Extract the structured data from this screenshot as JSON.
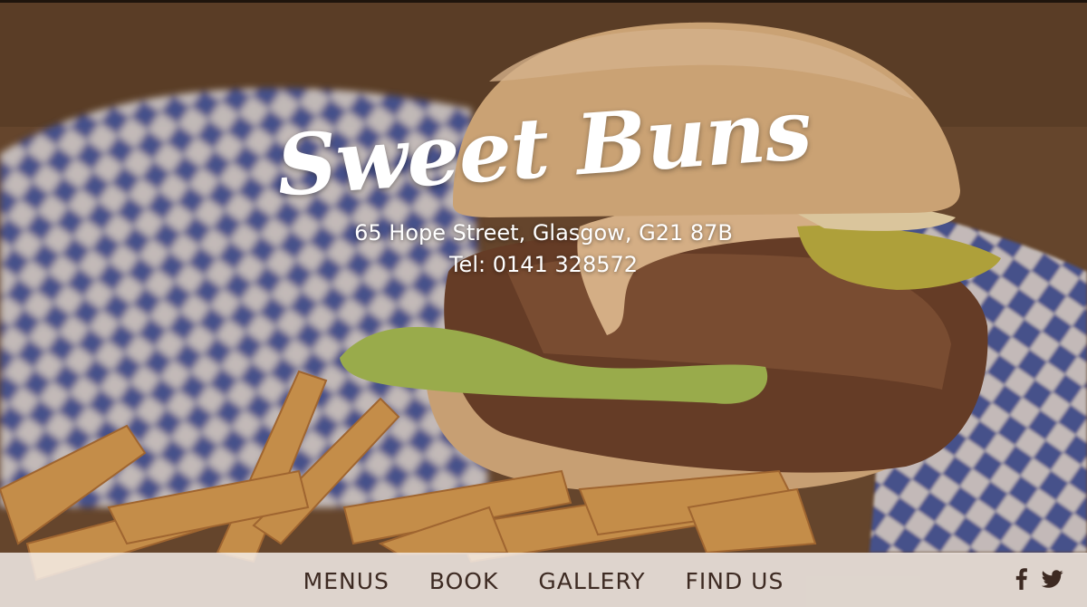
{
  "brand": {
    "title": "Sweet Buns",
    "address": "65 Hope Street, Glasgow, G21 87B",
    "phone": "Tel: 0141 328572"
  },
  "hero": {
    "image": "burger-and-fries-photo"
  },
  "nav": {
    "items": [
      {
        "label": "MENUS"
      },
      {
        "label": "BOOK"
      },
      {
        "label": "GALLERY"
      },
      {
        "label": "FIND US"
      }
    ]
  },
  "social": {
    "icons": [
      "facebook-icon",
      "twitter-icon"
    ]
  },
  "colors": {
    "nav_text": "#3d2a22",
    "nav_background": "#f5f0ec",
    "brand_text": "#ffffff",
    "checker_blue": "#2c4fb0"
  }
}
